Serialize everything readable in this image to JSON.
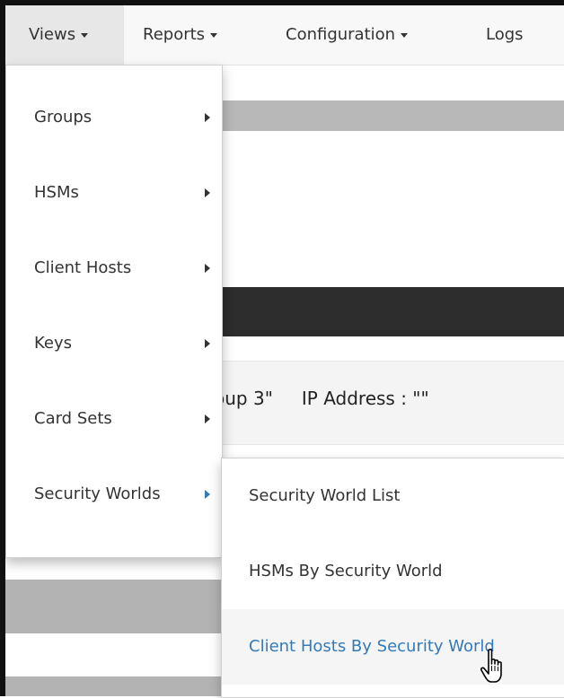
{
  "navbar": {
    "items": [
      {
        "label": "Views",
        "has_caret": true,
        "open": true
      },
      {
        "label": "Reports",
        "has_caret": true
      },
      {
        "label": "Configuration",
        "has_caret": true
      },
      {
        "label": "Logs",
        "has_caret": false
      }
    ]
  },
  "background": {
    "group_text": "oup 3\"",
    "ip_text": "IP Address : \"\""
  },
  "views_menu": {
    "items": [
      {
        "label": "Groups"
      },
      {
        "label": "HSMs"
      },
      {
        "label": "Client Hosts"
      },
      {
        "label": "Keys"
      },
      {
        "label": "Card Sets"
      },
      {
        "label": "Security Worlds",
        "active": true
      }
    ]
  },
  "security_worlds_submenu": {
    "items": [
      {
        "label": "Security World List"
      },
      {
        "label": "HSMs By Security World"
      },
      {
        "label": "Client Hosts By Security World",
        "hovered": true
      }
    ]
  },
  "colors": {
    "link_blue": "#337ab7",
    "navbar_bg": "#f8f8f8",
    "dark_band": "#2d2d2d"
  },
  "icons": [
    "chevron-right-icon",
    "caret-down-icon",
    "hand-pointer-cursor"
  ]
}
